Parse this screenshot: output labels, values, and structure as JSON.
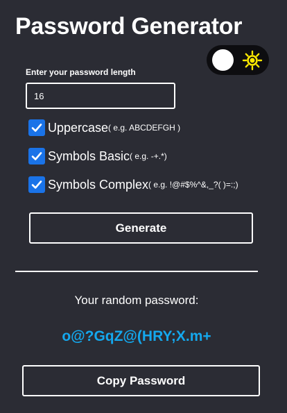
{
  "app": {
    "title": "Password Generator"
  },
  "theme_toggle": {
    "mode_icon": "sun-icon",
    "state": "dark",
    "sun_color": "#ffea00"
  },
  "length": {
    "label": "Enter your password length",
    "value": "16"
  },
  "options": [
    {
      "label": "Uppercase",
      "hint": "( e.g. ABCDEFGH )",
      "checked": true
    },
    {
      "label": "Symbols Basic",
      "hint": "( e.g. -+.*)",
      "checked": true
    },
    {
      "label": "Symbols Complex",
      "hint": "( e.g. !@#$%^&,_?( )=:;)",
      "checked": true
    }
  ],
  "actions": {
    "generate_label": "Generate",
    "copy_label": "Copy Password"
  },
  "result": {
    "label": "Your random password:",
    "password": "o@?GqZ@(HRY;X.m+"
  },
  "colors": {
    "background": "#2b2c34",
    "accent": "#14a8ee",
    "checkbox": "#1a73e8",
    "toggle_track": "#0d0d10"
  }
}
